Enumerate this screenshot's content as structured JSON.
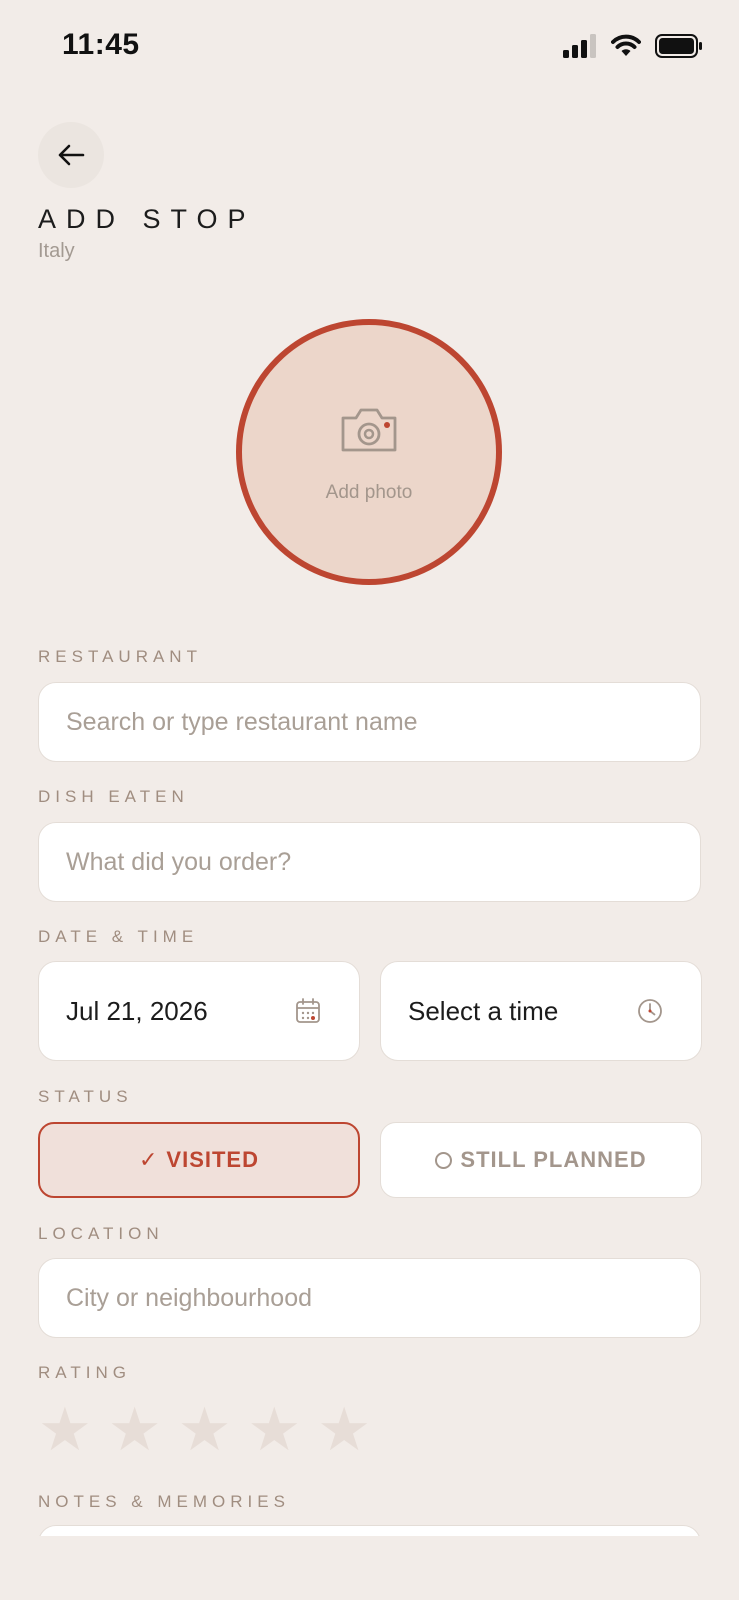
{
  "status_bar": {
    "time": "11:45"
  },
  "header": {
    "title": "ADD STOP",
    "subtitle": "Italy"
  },
  "photo": {
    "label": "Add photo"
  },
  "restaurant": {
    "label": "RESTAURANT",
    "placeholder": "Search or type restaurant name"
  },
  "dish": {
    "label": "DISH EATEN",
    "placeholder": "What did you order?"
  },
  "datetime": {
    "label": "DATE & TIME",
    "date_value": "Jul 21, 2026",
    "time_placeholder": "Select a time"
  },
  "status": {
    "label": "STATUS",
    "visited_label": "VISITED",
    "visited_check": "✓",
    "planned_label": "STILL PLANNED",
    "selected": "visited"
  },
  "location": {
    "label": "LOCATION",
    "placeholder": "City or neighbourhood"
  },
  "rating": {
    "label": "RATING",
    "max": 5,
    "value": 0,
    "star_glyph": "★"
  },
  "notes": {
    "label": "NOTES & MEMORIES"
  },
  "colors": {
    "accent": "#bd4631",
    "background": "#f2ece8",
    "muted_text": "#a08d80"
  }
}
